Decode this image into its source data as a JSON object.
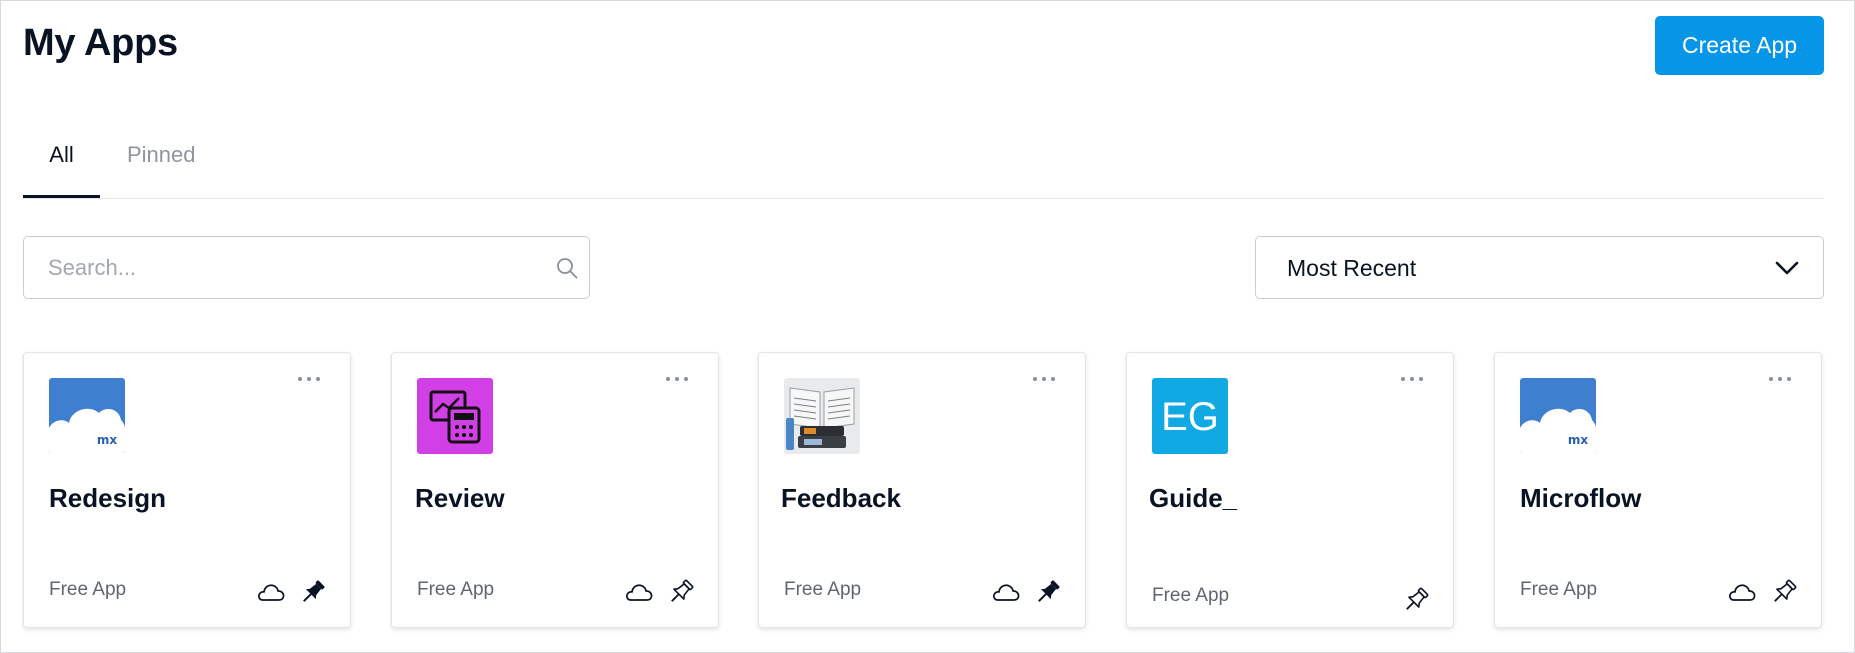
{
  "header": {
    "title": "My Apps",
    "create_label": "Create App"
  },
  "tabs": [
    {
      "label": "All",
      "active": true
    },
    {
      "label": "Pinned",
      "active": false
    }
  ],
  "search": {
    "placeholder": "Search...",
    "value": ""
  },
  "sort": {
    "selected": "Most Recent"
  },
  "apps": [
    {
      "name": "Redesign",
      "type": "Free App",
      "logo": "mx-cloud-logo",
      "cloud": true,
      "pinned": true
    },
    {
      "name": "Review",
      "type": "Free App",
      "logo": "calculator-chart-logo",
      "cloud": true,
      "pinned": false
    },
    {
      "name": "Feedback",
      "type": "Free App",
      "logo": "book-devices-photo-logo",
      "cloud": true,
      "pinned": true
    },
    {
      "name": "Guide_",
      "type": "Free App",
      "logo": "eg-letters-logo",
      "logo_text": "EG",
      "cloud": false,
      "pinned": false
    },
    {
      "name": "Microflow",
      "type": "Free App",
      "logo": "mx-cloud-logo",
      "cloud": true,
      "pinned": false
    }
  ],
  "logo_marks": {
    "mx": "mx"
  },
  "colors": {
    "accent": "#0795e8",
    "text": "#0a1324",
    "muted": "#8f959e",
    "mx_logo_bg": "#3f7fd0",
    "review_logo_bg": "#d23fe6",
    "eg_logo_bg": "#10a9e4"
  }
}
